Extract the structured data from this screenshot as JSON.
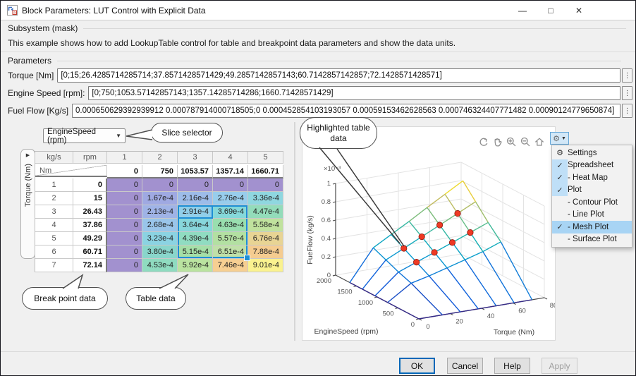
{
  "window": {
    "title": "Block Parameters: LUT Control with Explicit Data",
    "minimize": "—",
    "maximize": "□",
    "close": "✕"
  },
  "sections": {
    "subsystem_label": "Subsystem (mask)",
    "description": "This example shows how to add LookupTable control for table and breakpoint data  parameters and show the data units.",
    "parameters_label": "Parameters"
  },
  "params": {
    "torque": {
      "label": "Torque [Nm]",
      "value": "[0;15;26.4285714285714;37.8571428571429;49.2857142857143;60.7142857142857;72.1428571428571]"
    },
    "engine_speed": {
      "label": "Engine Speed [rpm]:",
      "value": "[0;750;1053.57142857143;1357.14285714286;1660.71428571429]"
    },
    "fuel_flow": {
      "label": "Fuel Flow [Kg/s]",
      "value": "0.000650629392939912 0.000787914000718505;0 0.000452854103193057 0.00059153462628563 0.000746324407771482 0.00090124779650874]"
    },
    "menu_dots": "⋮"
  },
  "slice_selector": {
    "value": "EngineSpeed (rpm)"
  },
  "spreadsheet": {
    "axis_strip_label": "Torque (Nm)",
    "expand_arrow": "▶",
    "unit_row": [
      "kg/s",
      "rpm"
    ],
    "unit_col": "Nm",
    "col_indices": [
      "1",
      "2",
      "3",
      "4",
      "5"
    ],
    "col_breakpoints": [
      "0",
      "750",
      "1053.57",
      "1357.14",
      "1660.71"
    ],
    "rows": [
      {
        "index": "1",
        "bp": "0",
        "cells": [
          "0",
          "0",
          "0",
          "0",
          "0"
        ],
        "colors": [
          "#a291cf",
          "#a291cf",
          "#a291cf",
          "#a291cf",
          "#a291cf"
        ]
      },
      {
        "index": "2",
        "bp": "15",
        "cells": [
          "0",
          "1.67e-4",
          "2.16e-4",
          "2.76e-4",
          "3.36e-4"
        ],
        "colors": [
          "#a291cf",
          "#9fa9e2",
          "#9dbce9",
          "#98cdec",
          "#8fd7e0"
        ]
      },
      {
        "index": "3",
        "bp": "26.43",
        "cells": [
          "0",
          "2.13e-4",
          "2.91e-4",
          "3.69e-4",
          "4.47e-4"
        ],
        "colors": [
          "#a291cf",
          "#9fb3e6",
          "#91cfe9",
          "#85d8da",
          "#93dcba"
        ]
      },
      {
        "index": "4",
        "bp": "37.86",
        "cells": [
          "0",
          "2.68e-4",
          "3.64e-4",
          "4.63e-4",
          "5.58e-4"
        ],
        "colors": [
          "#a291cf",
          "#99c5ea",
          "#87d6db",
          "#99dfaf",
          "#c0e29d"
        ]
      },
      {
        "index": "5",
        "bp": "49.29",
        "cells": [
          "0",
          "3.23e-4",
          "4.39e-4",
          "5.57e-4",
          "6.76e-4"
        ],
        "colors": [
          "#a291cf",
          "#8bd3e2",
          "#90dcc1",
          "#b3e0a2",
          "#e8d494"
        ]
      },
      {
        "index": "6",
        "bp": "60.71",
        "cells": [
          "0",
          "3.80e-4",
          "5.15e-4",
          "6.51e-4",
          "7.88e-4"
        ],
        "colors": [
          "#a291cf",
          "#89d6cb",
          "#a5dfa7",
          "#c0e0a8",
          "#f5cc90"
        ]
      },
      {
        "index": "7",
        "bp": "72.14",
        "cells": [
          "0",
          "4.53e-4",
          "5.92e-4",
          "7.46e-4",
          "9.01e-4"
        ],
        "colors": [
          "#a291cf",
          "#8fdbc0",
          "#bae3a0",
          "#f6cf92",
          "#faf28f"
        ]
      }
    ],
    "selection": {
      "r0": 2,
      "r1": 5,
      "c0": 2,
      "c1": 3,
      "active_r": 2,
      "active_c": 2
    },
    "selection_color": "#1e8fd5"
  },
  "chart_data": {
    "type": "mesh",
    "xlabel": "Torque (Nm)",
    "ylabel": "EngineSpeed (rpm)",
    "zlabel": "FueFlow (kg/s)",
    "z_exponent_label": "×10⁻³",
    "x": [
      0,
      15,
      26.43,
      37.86,
      49.29,
      60.71,
      72.14
    ],
    "y": [
      0,
      750,
      1053.57,
      1357.14,
      1660.71
    ],
    "z_e4": [
      [
        0,
        0,
        0,
        0,
        0
      ],
      [
        0,
        1.67,
        2.16,
        2.76,
        3.36
      ],
      [
        0,
        2.13,
        2.91,
        3.69,
        4.47
      ],
      [
        0,
        2.68,
        3.64,
        4.63,
        5.58
      ],
      [
        0,
        3.23,
        4.39,
        5.57,
        6.76
      ],
      [
        0,
        3.8,
        5.15,
        6.51,
        7.88
      ],
      [
        0,
        4.53,
        5.92,
        7.46,
        9.01
      ]
    ],
    "xlim": [
      0,
      80
    ],
    "ylim": [
      0,
      2000
    ],
    "zlim_e3": [
      0,
      1
    ],
    "xticks": [
      "0",
      "20",
      "40",
      "60",
      "80"
    ],
    "yticks": [
      "0",
      "500",
      "1000",
      "1500",
      "2000"
    ],
    "zticks": [
      "0",
      "0.2",
      "0.4",
      "0.6",
      "0.8",
      "1"
    ],
    "grid": true,
    "highlight": {
      "torque_idx": [
        2,
        3,
        4,
        5
      ],
      "speed_idx": [
        2,
        3
      ]
    },
    "marker_color": "#ee3a24",
    "marker_edge": "#8c1a10"
  },
  "plot_toolbar": {
    "icons": [
      "rotate",
      "pan",
      "zoom-in",
      "zoom-out",
      "home"
    ]
  },
  "settings_menu": {
    "button_caret": "▼",
    "check_glyph": "✓",
    "items": [
      {
        "label": "Settings",
        "icon": "gear",
        "checked": false,
        "highlighted": false
      },
      {
        "label": "Spreadsheet",
        "icon": "",
        "checked": true,
        "highlighted": false
      },
      {
        "label": "- Heat Map",
        "icon": "",
        "checked": true,
        "highlighted": false
      },
      {
        "label": "Plot",
        "icon": "",
        "checked": true,
        "highlighted": false
      },
      {
        "label": "- Contour Plot",
        "icon": "",
        "checked": false,
        "highlighted": false
      },
      {
        "label": "- Line Plot",
        "icon": "",
        "checked": false,
        "highlighted": false
      },
      {
        "label": "- Mesh Plot",
        "icon": "",
        "checked": true,
        "highlighted": true
      },
      {
        "label": "- Surface Plot",
        "icon": "",
        "checked": false,
        "highlighted": false
      }
    ]
  },
  "callouts": {
    "slice": "Slice selector",
    "highlighted": "Highlighted table data",
    "breakpoint": "Break point data",
    "tabledata": "Table data"
  },
  "footer": {
    "ok": "OK",
    "cancel": "Cancel",
    "help": "Help",
    "apply": "Apply"
  }
}
